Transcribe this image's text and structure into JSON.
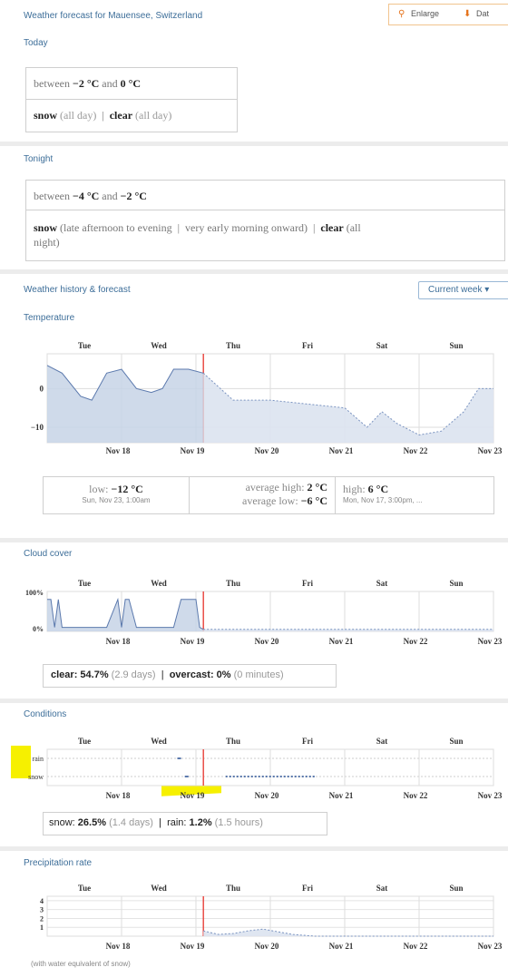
{
  "header": {
    "title": "Weather forecast for Mauensee, Switzerland",
    "enlarge": "Enlarge",
    "data": "Dat"
  },
  "today": {
    "label": "Today",
    "line1": "between −2 °C and 0 °C",
    "line2": "snow (all day) | clear (all day)"
  },
  "tonight": {
    "label": "Tonight",
    "line1": "between −4 °C and −2 °C",
    "line2a": "snow (late afternoon to evening | very early morning onward) | clear (all",
    "line2b": "night)"
  },
  "history": {
    "title": "Weather history & forecast",
    "select": "Current week ▾"
  },
  "days_top": [
    "Tue",
    "Wed",
    "Thu",
    "Fri",
    "Sat",
    "Sun"
  ],
  "days_bottom": [
    "Nov 18",
    "Nov 19",
    "Nov 20",
    "Nov 21",
    "Nov 22",
    "Nov 23"
  ],
  "temperature": {
    "title": "Temperature",
    "stats": {
      "low_label": "low:",
      "low_val": "−12 °C",
      "low_sub": "Sun, Nov 23, 1:00am",
      "avg_high_label": "average high:",
      "avg_high_val": "2 °C",
      "avg_low_label": "average low:",
      "avg_low_val": "−6 °C",
      "high_label": "high:",
      "high_val": "6 °C",
      "high_sub": "Mon, Nov 17, 3:00pm, ..."
    }
  },
  "cloud": {
    "title": "Cloud cover",
    "stats": "clear: 54.7% (2.9 days) | overcast: 0% (0 minutes)"
  },
  "conditions": {
    "title": "Conditions",
    "stats": "snow: 26.5% (1.4 days) | rain: 1.2% (1.5 hours)"
  },
  "precip": {
    "title": "Precipitation rate",
    "note": "(with water equivalent of snow)"
  },
  "chart_data": [
    {
      "type": "area",
      "title": "Temperature",
      "ylabel": "°C",
      "ylim": [
        -14,
        9
      ],
      "y_ticks": [
        0,
        -10
      ],
      "x_tick_labels_top": [
        "Tue",
        "Wed",
        "Thu",
        "Fri",
        "Sat",
        "Sun"
      ],
      "x_tick_labels_bottom": [
        "Nov 18",
        "Nov 19",
        "Nov 20",
        "Nov 21",
        "Nov 22",
        "Nov 23"
      ],
      "x_range_days": [
        0,
        6
      ],
      "now_day": 2.1,
      "series": [
        {
          "x": [
            0,
            0.2,
            0.45,
            0.6,
            0.8,
            1.0,
            1.2,
            1.4,
            1.55,
            1.7,
            1.9,
            2.1,
            2.5,
            3.0,
            3.5,
            4.0,
            4.3,
            4.5,
            4.7,
            5.0,
            5.3,
            5.6,
            5.8,
            6.0
          ],
          "y": [
            6,
            4,
            -2,
            -3,
            4,
            5,
            0,
            -1,
            0,
            5,
            5,
            4,
            -3,
            -3,
            -4,
            -5,
            -10,
            -6,
            -9,
            -12,
            -11,
            -6,
            0,
            0
          ]
        }
      ]
    },
    {
      "type": "area",
      "title": "Cloud cover",
      "ylim": [
        0,
        100
      ],
      "y_tick_labels": [
        "100%",
        "0%"
      ],
      "x_tick_labels_top": [
        "Tue",
        "Wed",
        "Thu",
        "Fri",
        "Sat",
        "Sun"
      ],
      "x_tick_labels_bottom": [
        "Nov 18",
        "Nov 19",
        "Nov 20",
        "Nov 21",
        "Nov 22",
        "Nov 23"
      ],
      "now_day": 2.1,
      "series": [
        {
          "x": [
            0,
            0.05,
            0.1,
            0.15,
            0.2,
            0.3,
            0.4,
            0.5,
            0.8,
            0.95,
            1.0,
            1.05,
            1.1,
            1.2,
            1.5,
            1.7,
            1.8,
            2.0,
            2.05,
            2.1,
            6.0
          ],
          "y": [
            80,
            80,
            10,
            80,
            10,
            10,
            10,
            10,
            10,
            80,
            10,
            80,
            80,
            10,
            10,
            10,
            80,
            80,
            10,
            5,
            5
          ]
        }
      ]
    },
    {
      "type": "timeline",
      "title": "Conditions",
      "categories": [
        "rain",
        "snow"
      ],
      "x_tick_labels_top": [
        "Tue",
        "Wed",
        "Thu",
        "Fri",
        "Sat",
        "Sun"
      ],
      "x_tick_labels_bottom": [
        "Nov 18",
        "Nov 19",
        "Nov 20",
        "Nov 21",
        "Nov 22",
        "Nov 23"
      ],
      "now_day": 2.1,
      "segments": [
        {
          "cat": "rain",
          "x": [
            1.75,
            1.8
          ]
        },
        {
          "cat": "snow",
          "x": [
            1.85,
            1.9
          ]
        },
        {
          "cat": "snow",
          "x": [
            2.4,
            3.6
          ]
        }
      ]
    },
    {
      "type": "area",
      "title": "Precipitation rate",
      "y_ticks": [
        1,
        2,
        3,
        4
      ],
      "ylim": [
        0,
        4.5
      ],
      "x_tick_labels_top": [
        "Tue",
        "Wed",
        "Thu",
        "Fri",
        "Sat",
        "Sun"
      ],
      "x_tick_labels_bottom": [
        "Nov 18",
        "Nov 19",
        "Nov 20",
        "Nov 21",
        "Nov 22",
        "Nov 23"
      ],
      "now_day": 2.1,
      "series": [
        {
          "x": [
            2.1,
            2.3,
            2.5,
            2.7,
            2.9,
            3.1,
            3.3,
            3.6,
            6.0
          ],
          "y": [
            0.6,
            0.2,
            0.3,
            0.6,
            0.8,
            0.5,
            0.2,
            0,
            0
          ]
        }
      ]
    }
  ]
}
